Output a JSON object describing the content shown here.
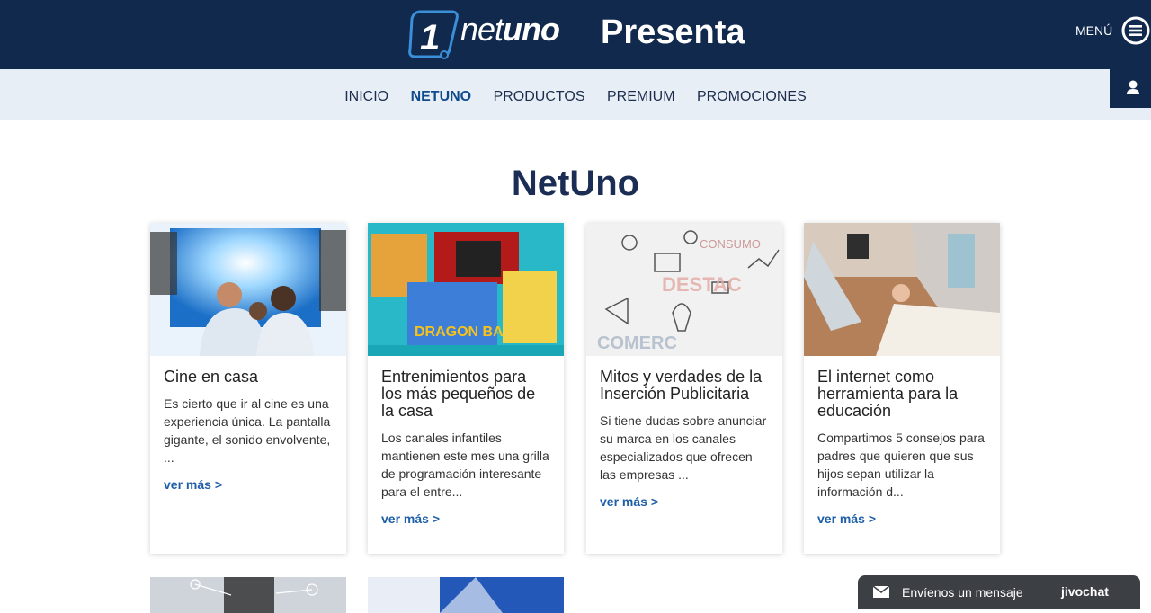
{
  "header": {
    "brand": {
      "prefix": "net",
      "suffix": "uno"
    },
    "title": "Presenta",
    "menu_label": "MENÚ"
  },
  "nav": {
    "items": [
      "INICIO",
      "NETUNO",
      "PRODUCTOS",
      "PREMIUM",
      "PROMOCIONES"
    ],
    "active": "NETUNO"
  },
  "page": {
    "title": "NetUno"
  },
  "cards": [
    {
      "title": "Cine en casa",
      "excerpt": "Es cierto que ir al cine es una experiencia única. La pantalla gigante, el sonido envolvente, ...",
      "more": "ver más >"
    },
    {
      "title": "Entrenimientos para los más pequeños de la casa",
      "excerpt": "Los canales infantiles mantienen este mes una grilla de programación interesante para el entre...",
      "more": "ver más >"
    },
    {
      "title": "Mitos y verdades de la Inserción Publicitaria",
      "excerpt": "Si tiene dudas sobre anunciar su marca en los canales especializados que ofrecen las empresas ...",
      "more": "ver más >"
    },
    {
      "title": "El internet como herramienta para la educación",
      "excerpt": "Compartimos 5 consejos para padres que quieren que sus hijos sepan utilizar la información d...",
      "more": "ver más >"
    }
  ],
  "chat": {
    "label": "Envíenos un mensaje",
    "brand": "jivochat"
  },
  "colors": {
    "header_bg": "#10294d",
    "nav_bg": "#e8eef6",
    "link": "#1e5fa8"
  },
  "icons": [
    "menu-icon",
    "user-icon",
    "envelope-icon",
    "netuno-logo"
  ]
}
